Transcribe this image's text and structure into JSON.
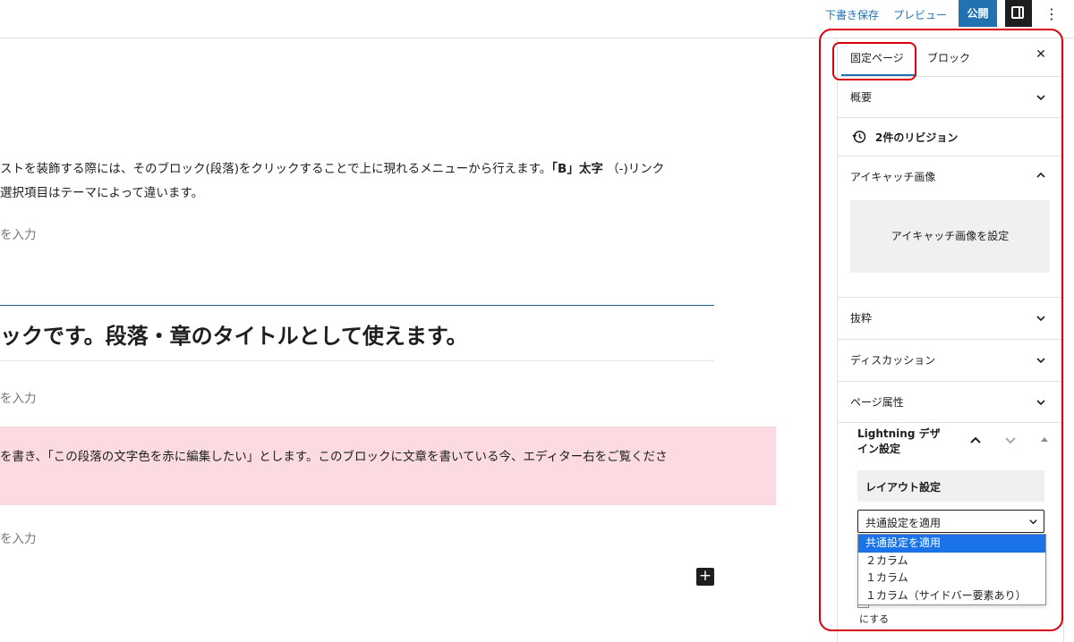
{
  "toolbar": {
    "save_draft": "下書き保存",
    "preview": "プレビュー",
    "publish": "公開"
  },
  "content": {
    "para1_line1": "ストを装飾する際には、そのブロック(段落)をクリックすることで上に現れるメニューから行えます。",
    "para1_bold": "「B」太字",
    "para1_tail": "（-)リンク",
    "para1_line2": "選択項目はテーマによって違います。",
    "placeholder": "を入力",
    "heading": "ックです。段落・章のタイトルとして使えます。",
    "pink_text": "を書き、「この段落の文字色を赤に編集したい」とします。このブロックに文章を書いている今、エディター右をご覧くださ",
    "pink_bg": "#fbdbe1"
  },
  "sidebar": {
    "tab_page": "固定ページ",
    "tab_block": "ブロック",
    "summary": "概要",
    "revisions": "2件のリビジョン",
    "featured_image": "アイキャッチ画像",
    "set_featured_image": "アイキャッチ画像を設定",
    "excerpt": "抜粋",
    "discussion": "ディスカッション",
    "page_attributes": "ページ属性",
    "lightning_title": "Lightning デザイン設定",
    "layout_settings": "レイアウト設定",
    "layout_selected": "共通設定を適用",
    "layout_options": [
      "共通設定を適用",
      "２カラム",
      "１カラム",
      "１カラム（サイドバー要素あり）"
    ],
    "behind_text": "にする"
  },
  "colors": {
    "accent": "#2271b1",
    "highlight": "#d8000c",
    "dropdown_selected": "#1a73e8"
  }
}
